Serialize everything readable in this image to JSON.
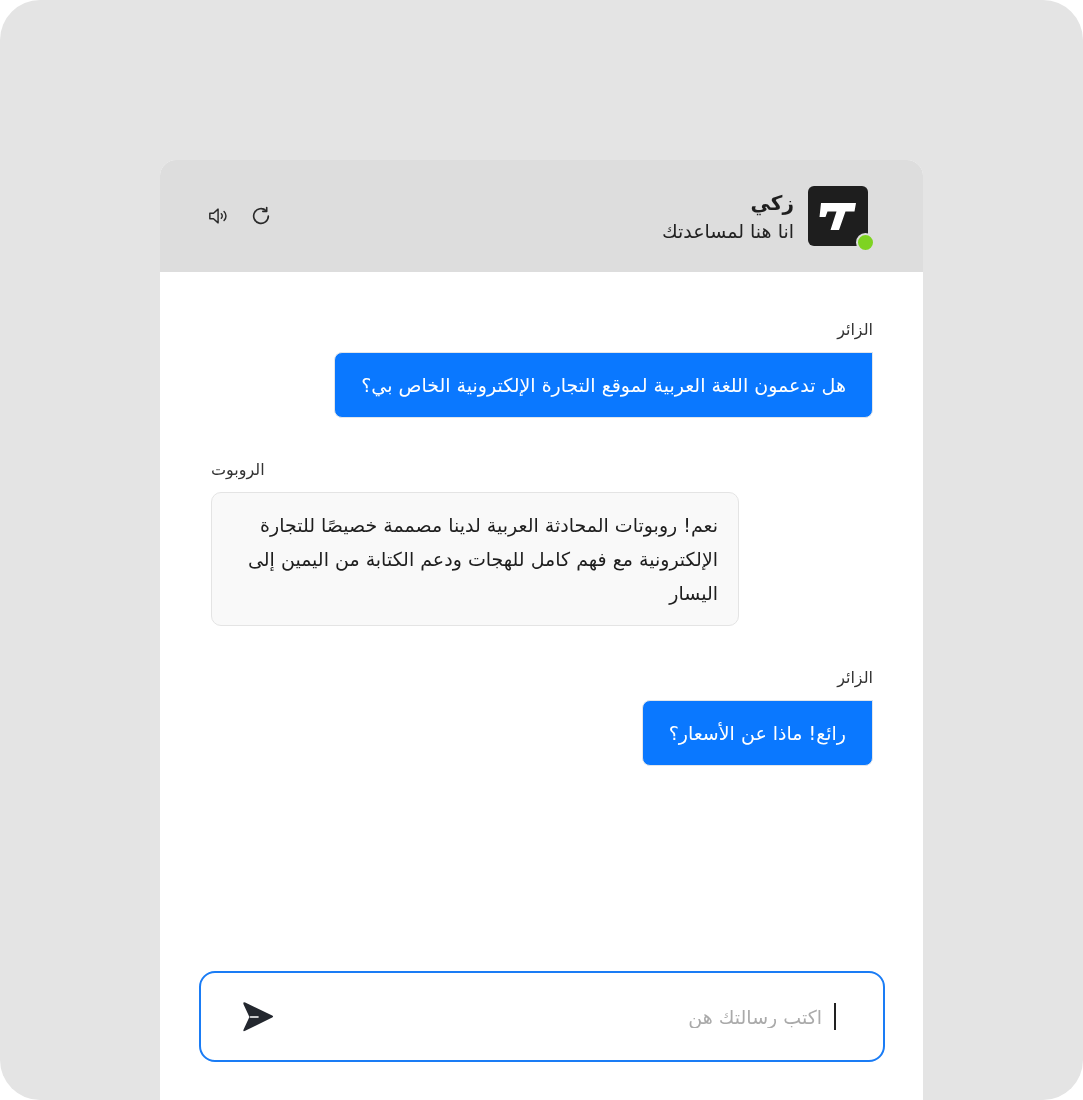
{
  "assistant": {
    "name": "زكي",
    "tagline": "انا هنا لمساعدتك",
    "online": true
  },
  "messages": [
    {
      "kind": "visitor",
      "label": "الزائر",
      "text": "هل تدعمون اللغة العربية لموقع التجارة الإلكترونية الخاص بي؟"
    },
    {
      "kind": "bot",
      "label": "الروبوت",
      "text": "نعم! روبوتات المحادثة العربية لدينا مصممة خصيصًا للتجارة الإلكترونية مع فهم كامل للهجات ودعم الكتابة من اليمين إلى اليسار"
    },
    {
      "kind": "visitor",
      "label": "الزائر",
      "text": "رائع! ماذا عن الأسعار؟"
    }
  ],
  "composer": {
    "placeholder": "اكتب رسالتك هن",
    "focused": true
  }
}
